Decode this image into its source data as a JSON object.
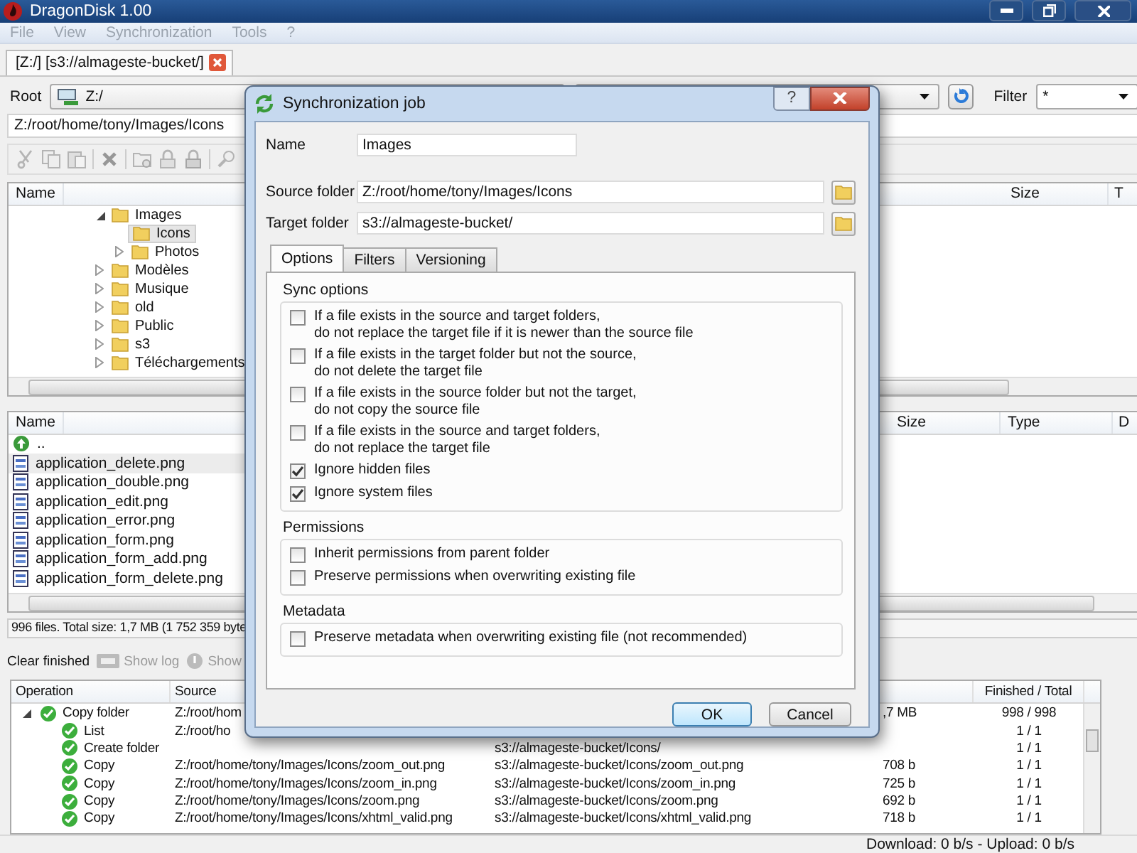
{
  "window": {
    "title": "DragonDisk 1.00"
  },
  "menu": [
    {
      "label": "File",
      "disabled": true
    },
    {
      "label": "View",
      "disabled": true
    },
    {
      "label": "Synchronization",
      "disabled": true
    },
    {
      "label": "Tools",
      "disabled": true
    },
    {
      "label": "?",
      "disabled": true
    }
  ],
  "tabs": [
    {
      "label": "[Z:/] [s3://almageste-bucket/]",
      "selected": true
    }
  ],
  "left_pane": {
    "root_label": "Root",
    "root_value": "Z:/",
    "path": "Z:/root/home/tony/Images/Icons",
    "tree": {
      "column": "Name",
      "items": [
        {
          "label": "Images",
          "expanded": true,
          "selected": false,
          "children": [
            {
              "label": "Icons",
              "selected": true
            },
            {
              "label": "Photos",
              "expanded": false,
              "selected": false
            }
          ]
        },
        {
          "label": "Modèles",
          "expanded": false,
          "selected": false
        },
        {
          "label": "Musique",
          "expanded": false,
          "selected": false
        },
        {
          "label": "old",
          "expanded": false,
          "selected": false
        },
        {
          "label": "Public",
          "expanded": false,
          "selected": false
        },
        {
          "label": "s3",
          "expanded": false,
          "selected": false
        },
        {
          "label": "Téléchargements",
          "expanded": false,
          "selected": false
        }
      ]
    },
    "files": {
      "column": "Name",
      "items": [
        {
          "name": "..",
          "kind": "parent",
          "selected": false
        },
        {
          "name": "application_delete.png",
          "kind": "image",
          "selected": true
        },
        {
          "name": "application_double.png",
          "kind": "image",
          "selected": false
        },
        {
          "name": "application_edit.png",
          "kind": "image",
          "selected": false
        },
        {
          "name": "application_error.png",
          "kind": "image",
          "selected": false
        },
        {
          "name": "application_form.png",
          "kind": "image",
          "selected": false
        },
        {
          "name": "application_form_add.png",
          "kind": "image",
          "selected": false
        },
        {
          "name": "application_form_delete.png",
          "kind": "image",
          "selected": false
        }
      ]
    },
    "status": "996 files. Total size: 1,7 MB (1 752 359 byte"
  },
  "right_pane": {
    "filter_label": "Filter",
    "filter_value": "*",
    "tree_columns": [
      "Size",
      "T"
    ],
    "file_columns": [
      "Size",
      "Type",
      "D"
    ]
  },
  "transfers": {
    "toolbar": [
      {
        "label": "Clear finished",
        "kind": "clear",
        "disabled": false
      },
      {
        "label": "Show log",
        "kind": "log",
        "disabled": true
      },
      {
        "label": "Show",
        "kind": "info",
        "disabled": true
      }
    ],
    "columns": {
      "operation": "Operation",
      "source": "Source",
      "finished": "Finished / Total"
    },
    "rows": [
      {
        "operation": "Copy folder",
        "done": true,
        "source": "Z:/root/hom",
        "size": ",7 MB",
        "finished": "998 / 998",
        "expanded": true,
        "children": [
          {
            "operation": "List",
            "done": true,
            "source": "Z:/root/ho",
            "finished": "1 / 1"
          },
          {
            "operation": "Create folder",
            "done": true,
            "target": "s3://almageste-bucket/Icons/",
            "finished": "1 / 1"
          },
          {
            "operation": "Copy",
            "done": true,
            "source": "Z:/root/home/tony/Images/Icons/zoom_out.png",
            "target": "s3://almageste-bucket/Icons/zoom_out.png",
            "size": "708 b",
            "finished": "1 / 1"
          },
          {
            "operation": "Copy",
            "done": true,
            "source": "Z:/root/home/tony/Images/Icons/zoom_in.png",
            "target": "s3://almageste-bucket/Icons/zoom_in.png",
            "size": "725 b",
            "finished": "1 / 1"
          },
          {
            "operation": "Copy",
            "done": true,
            "source": "Z:/root/home/tony/Images/Icons/zoom.png",
            "target": "s3://almageste-bucket/Icons/zoom.png",
            "size": "692 b",
            "finished": "1 / 1"
          },
          {
            "operation": "Copy",
            "done": true,
            "source": "Z:/root/home/tony/Images/Icons/xhtml_valid.png",
            "target": "s3://almageste-bucket/Icons/xhtml_valid.png",
            "size": "718 b",
            "finished": "1 / 1"
          }
        ]
      }
    ]
  },
  "status_bar": "Download: 0 b/s - Upload: 0 b/s",
  "dialog": {
    "title": "Synchronization job",
    "help_label": "?",
    "fields": [
      {
        "label": "Name",
        "value": "Images",
        "kind": "text"
      },
      {
        "label": "Source folder",
        "value": "Z:/root/home/tony/Images/Icons",
        "kind": "folder"
      },
      {
        "label": "Target folder",
        "value": "s3://almageste-bucket/",
        "kind": "folder"
      }
    ],
    "tabs": [
      {
        "label": "Options",
        "selected": true
      },
      {
        "label": "Filters",
        "selected": false
      },
      {
        "label": "Versioning",
        "selected": false
      }
    ],
    "groups": [
      {
        "title": "Sync options",
        "options": [
          {
            "label": "If a file exists in the source and target folders,\ndo not replace the target file if it is newer than the source file",
            "checked": false
          },
          {
            "label": "If a file exists in the target folder but not the source,\ndo not delete the target file",
            "checked": false
          },
          {
            "label": "If a file exists in the source folder but not the target,\ndo not copy the source file",
            "checked": false
          },
          {
            "label": "If a file exists in the source and target folders,\ndo not replace the target file",
            "checked": false
          },
          {
            "label": "Ignore hidden files",
            "checked": true
          },
          {
            "label": "Ignore system files",
            "checked": true
          }
        ]
      },
      {
        "title": "Permissions",
        "options": [
          {
            "label": "Inherit permissions from parent folder",
            "checked": false
          },
          {
            "label": "Preserve permissions when overwriting existing file",
            "checked": false
          }
        ]
      },
      {
        "title": "Metadata",
        "options": [
          {
            "label": "Preserve metadata when overwriting existing file (not recommended)",
            "checked": false
          }
        ]
      }
    ],
    "buttons": [
      {
        "label": "OK",
        "default": true
      },
      {
        "label": "Cancel",
        "default": false
      }
    ]
  }
}
